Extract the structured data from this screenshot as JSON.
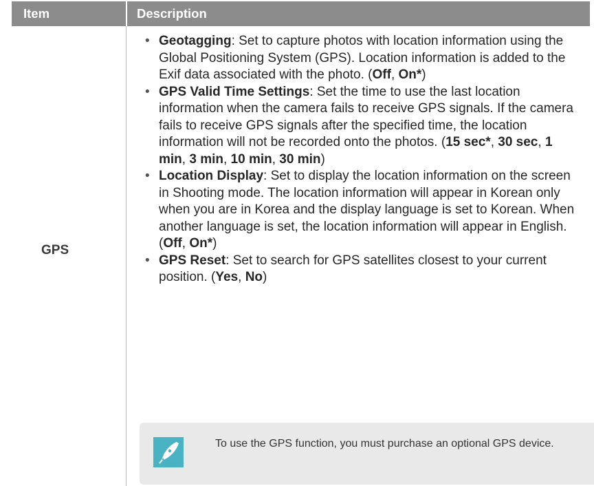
{
  "table": {
    "header": {
      "item": "Item",
      "description": "Description"
    },
    "row": {
      "item": "GPS",
      "bullets": [
        {
          "term": "Geotagging",
          "text_before": ": Set to capture photos with location information using the Global Positioning System (GPS). Location information is added to the Exif data associated with the photo. (",
          "options": [
            "Off",
            "On*"
          ],
          "text_after": ")"
        },
        {
          "term": "GPS Valid Time Settings",
          "text_before": ": Set the time to use the last location information when the camera fails to receive GPS signals. If the camera fails to receive GPS signals after the specified time, the location information will not be recorded onto the photos. (",
          "options": [
            "15 sec*",
            "30 sec",
            "1 min",
            "3 min",
            "10 min",
            "30 min"
          ],
          "text_after": ")"
        },
        {
          "term": "Location Display",
          "text_before": ": Set to display the location information on the screen in Shooting mode. The location information will appear in Korean only when you are in Korea and the display language is set to Korean. When another language is set, the location information will appear in English. (",
          "options": [
            "Off",
            "On*"
          ],
          "text_after": ")"
        },
        {
          "term": "GPS Reset",
          "text_before": ": Set to search for GPS satellites closest to your current position. (",
          "options": [
            "Yes",
            "No"
          ],
          "text_after": ")"
        }
      ],
      "note": {
        "icon": "pen-nib-icon",
        "text": "To use the GPS function, you must purchase an optional GPS device."
      }
    }
  },
  "colors": {
    "header_bg": "#8c8c8c",
    "note_bg": "#e9e9e9",
    "note_icon": "#49b3c3"
  }
}
